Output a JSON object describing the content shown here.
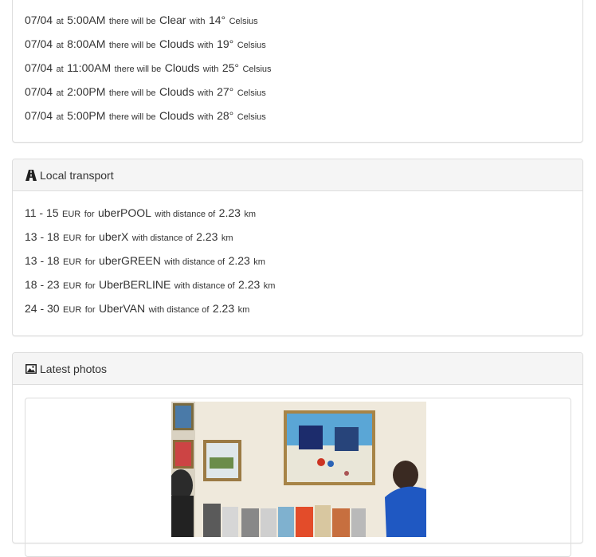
{
  "weather": {
    "rows": [
      {
        "date": "07/04",
        "at": "at",
        "time": "5:00AM",
        "there": "there will be",
        "cond": "Clear",
        "with": "with",
        "temp": "14°",
        "unit": "Celsius"
      },
      {
        "date": "07/04",
        "at": "at",
        "time": "8:00AM",
        "there": "there will be",
        "cond": "Clouds",
        "with": "with",
        "temp": "19°",
        "unit": "Celsius"
      },
      {
        "date": "07/04",
        "at": "at",
        "time": "11:00AM",
        "there": "there will be",
        "cond": "Clouds",
        "with": "with",
        "temp": "25°",
        "unit": "Celsius"
      },
      {
        "date": "07/04",
        "at": "at",
        "time": "2:00PM",
        "there": "there will be",
        "cond": "Clouds",
        "with": "with",
        "temp": "27°",
        "unit": "Celsius"
      },
      {
        "date": "07/04",
        "at": "at",
        "time": "5:00PM",
        "there": "there will be",
        "cond": "Clouds",
        "with": "with",
        "temp": "28°",
        "unit": "Celsius"
      }
    ]
  },
  "transport": {
    "title": "Local transport",
    "icon": "road-icon",
    "rows": [
      {
        "range": "11 - 15",
        "currency": "EUR",
        "for": "for",
        "product": "uberPOOL",
        "dist_text": "with distance of",
        "dist": "2.23",
        "unit": "km"
      },
      {
        "range": "13 - 18",
        "currency": "EUR",
        "for": "for",
        "product": "uberX",
        "dist_text": "with distance of",
        "dist": "2.23",
        "unit": "km"
      },
      {
        "range": "13 - 18",
        "currency": "EUR",
        "for": "for",
        "product": "uberGREEN",
        "dist_text": "with distance of",
        "dist": "2.23",
        "unit": "km"
      },
      {
        "range": "18 - 23",
        "currency": "EUR",
        "for": "for",
        "product": "UberBERLINE",
        "dist_text": "with distance of",
        "dist": "2.23",
        "unit": "km"
      },
      {
        "range": "24 - 30",
        "currency": "EUR",
        "for": "for",
        "product": "UberVAN",
        "dist_text": "with distance of",
        "dist": "2.23",
        "unit": "km"
      }
    ]
  },
  "photos": {
    "title": "Latest photos",
    "icon": "picture-icon"
  }
}
